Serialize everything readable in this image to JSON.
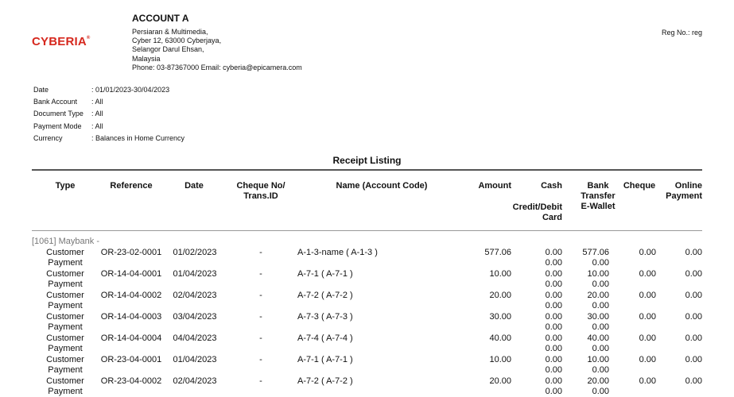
{
  "company": {
    "logo_text": "CYBERIA",
    "logo_mark": "®",
    "name": "ACCOUNT A",
    "address_lines": [
      "Persiaran & Multimedia,",
      "Cyber 12, 63000 Cyberjaya,",
      "Selangor Darul Ehsan,",
      "Malaysia",
      "Phone: 03-87367000 Email: cyberia@epicamera.com"
    ],
    "reg_no": "Reg No.: reg"
  },
  "filters": [
    {
      "label": "Date",
      "value": ": 01/01/2023-30/04/2023"
    },
    {
      "label": "Bank Account",
      "value": ": All"
    },
    {
      "label": "Document Type",
      "value": ": All"
    },
    {
      "label": "Payment Mode",
      "value": ": All"
    },
    {
      "label": "Currency",
      "value": ": Balances in Home Currency"
    }
  ],
  "report_title": "Receipt Listing",
  "headers": {
    "type": "Type",
    "reference": "Reference",
    "date": "Date",
    "cheque_1": "Cheque No/",
    "cheque_2": "Trans.ID",
    "name": "Name (Account Code)",
    "amount": "Amount",
    "cash": "Cash",
    "credit_1": "Credit/Debit",
    "credit_2": "Card",
    "bank_1": "Bank",
    "bank_2": "Transfer",
    "bank_3": "E-Wallet",
    "cheque": "Cheque",
    "online_1": "Online",
    "online_2": "Payment"
  },
  "group_label": "[1061] Maybank -",
  "rows": [
    {
      "type_1": "Customer",
      "type_2": "Payment",
      "reference": "OR-23-02-0001",
      "date": "01/02/2023",
      "cheque_no": "-",
      "name": "A-1-3-name ( A-1-3 )",
      "amount": "577.06",
      "cash": "0.00",
      "credit": "0.00",
      "bank": "577.06",
      "ewallet": "0.00",
      "cheque": "0.00",
      "online": "0.00"
    },
    {
      "type_1": "Customer",
      "type_2": "Payment",
      "reference": "OR-14-04-0001",
      "date": "01/04/2023",
      "cheque_no": "-",
      "name": "A-7-1 ( A-7-1 )",
      "amount": "10.00",
      "cash": "0.00",
      "credit": "0.00",
      "bank": "10.00",
      "ewallet": "0.00",
      "cheque": "0.00",
      "online": "0.00"
    },
    {
      "type_1": "Customer",
      "type_2": "Payment",
      "reference": "OR-14-04-0002",
      "date": "02/04/2023",
      "cheque_no": "-",
      "name": "A-7-2 ( A-7-2 )",
      "amount": "20.00",
      "cash": "0.00",
      "credit": "0.00",
      "bank": "20.00",
      "ewallet": "0.00",
      "cheque": "0.00",
      "online": "0.00"
    },
    {
      "type_1": "Customer",
      "type_2": "Payment",
      "reference": "OR-14-04-0003",
      "date": "03/04/2023",
      "cheque_no": "-",
      "name": "A-7-3 ( A-7-3 )",
      "amount": "30.00",
      "cash": "0.00",
      "credit": "0.00",
      "bank": "30.00",
      "ewallet": "0.00",
      "cheque": "0.00",
      "online": "0.00"
    },
    {
      "type_1": "Customer",
      "type_2": "Payment",
      "reference": "OR-14-04-0004",
      "date": "04/04/2023",
      "cheque_no": "-",
      "name": "A-7-4 ( A-7-4 )",
      "amount": "40.00",
      "cash": "0.00",
      "credit": "0.00",
      "bank": "40.00",
      "ewallet": "0.00",
      "cheque": "0.00",
      "online": "0.00"
    },
    {
      "type_1": "Customer",
      "type_2": "Payment",
      "reference": "OR-23-04-0001",
      "date": "01/04/2023",
      "cheque_no": "-",
      "name": "A-7-1 ( A-7-1 )",
      "amount": "10.00",
      "cash": "0.00",
      "credit": "0.00",
      "bank": "10.00",
      "ewallet": "0.00",
      "cheque": "0.00",
      "online": "0.00"
    },
    {
      "type_1": "Customer",
      "type_2": "Payment",
      "reference": "OR-23-04-0002",
      "date": "02/04/2023",
      "cheque_no": "-",
      "name": "A-7-2 ( A-7-2 )",
      "amount": "20.00",
      "cash": "0.00",
      "credit": "0.00",
      "bank": "20.00",
      "ewallet": "0.00",
      "cheque": "0.00",
      "online": "0.00"
    }
  ]
}
